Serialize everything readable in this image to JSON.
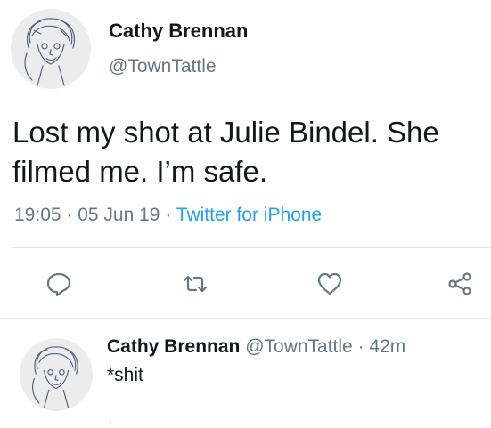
{
  "tweet": {
    "author_name": "Cathy Brennan",
    "author_handle": "@TownTattle",
    "text": "Lost my shot at Julie Bindel. She filmed me. I’m safe.",
    "time": "19:05",
    "date": "05 Jun 19",
    "separator": " · ",
    "source": "Twitter for iPhone"
  },
  "actions": {
    "reply_icon": "reply-icon",
    "retweet_icon": "retweet-icon",
    "like_icon": "heart-icon",
    "share_icon": "share-icon"
  },
  "reply": {
    "author_name": "Cathy Brennan",
    "author_handle": "@TownTattle",
    "age": "42m",
    "separator": " · ",
    "text": "*shit"
  },
  "colors": {
    "text": "#14171a",
    "secondary": "#657786",
    "link": "#1da1f2",
    "divider": "#e1e8ed"
  }
}
